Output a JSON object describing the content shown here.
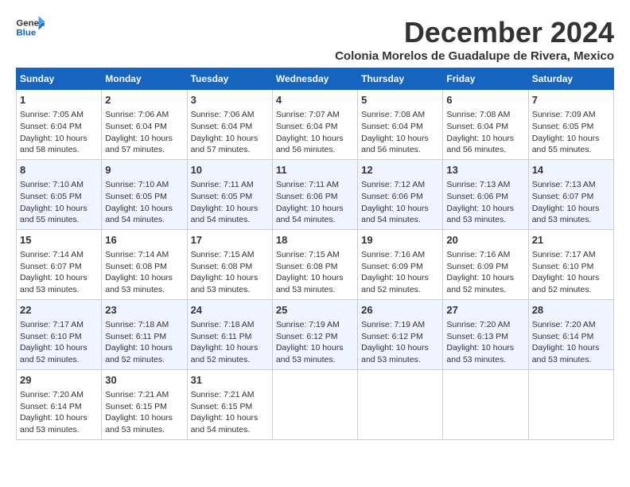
{
  "header": {
    "logo_line1": "General",
    "logo_line2": "Blue",
    "title": "December 2024",
    "subtitle": "Colonia Morelos de Guadalupe de Rivera, Mexico"
  },
  "calendar": {
    "weekdays": [
      "Sunday",
      "Monday",
      "Tuesday",
      "Wednesday",
      "Thursday",
      "Friday",
      "Saturday"
    ],
    "weeks": [
      [
        {
          "day": "1",
          "lines": [
            "Sunrise: 7:05 AM",
            "Sunset: 6:04 PM",
            "Daylight: 10 hours",
            "and 58 minutes."
          ]
        },
        {
          "day": "2",
          "lines": [
            "Sunrise: 7:06 AM",
            "Sunset: 6:04 PM",
            "Daylight: 10 hours",
            "and 57 minutes."
          ]
        },
        {
          "day": "3",
          "lines": [
            "Sunrise: 7:06 AM",
            "Sunset: 6:04 PM",
            "Daylight: 10 hours",
            "and 57 minutes."
          ]
        },
        {
          "day": "4",
          "lines": [
            "Sunrise: 7:07 AM",
            "Sunset: 6:04 PM",
            "Daylight: 10 hours",
            "and 56 minutes."
          ]
        },
        {
          "day": "5",
          "lines": [
            "Sunrise: 7:08 AM",
            "Sunset: 6:04 PM",
            "Daylight: 10 hours",
            "and 56 minutes."
          ]
        },
        {
          "day": "6",
          "lines": [
            "Sunrise: 7:08 AM",
            "Sunset: 6:04 PM",
            "Daylight: 10 hours",
            "and 56 minutes."
          ]
        },
        {
          "day": "7",
          "lines": [
            "Sunrise: 7:09 AM",
            "Sunset: 6:05 PM",
            "Daylight: 10 hours",
            "and 55 minutes."
          ]
        }
      ],
      [
        {
          "day": "8",
          "lines": [
            "Sunrise: 7:10 AM",
            "Sunset: 6:05 PM",
            "Daylight: 10 hours",
            "and 55 minutes."
          ]
        },
        {
          "day": "9",
          "lines": [
            "Sunrise: 7:10 AM",
            "Sunset: 6:05 PM",
            "Daylight: 10 hours",
            "and 54 minutes."
          ]
        },
        {
          "day": "10",
          "lines": [
            "Sunrise: 7:11 AM",
            "Sunset: 6:05 PM",
            "Daylight: 10 hours",
            "and 54 minutes."
          ]
        },
        {
          "day": "11",
          "lines": [
            "Sunrise: 7:11 AM",
            "Sunset: 6:06 PM",
            "Daylight: 10 hours",
            "and 54 minutes."
          ]
        },
        {
          "day": "12",
          "lines": [
            "Sunrise: 7:12 AM",
            "Sunset: 6:06 PM",
            "Daylight: 10 hours",
            "and 54 minutes."
          ]
        },
        {
          "day": "13",
          "lines": [
            "Sunrise: 7:13 AM",
            "Sunset: 6:06 PM",
            "Daylight: 10 hours",
            "and 53 minutes."
          ]
        },
        {
          "day": "14",
          "lines": [
            "Sunrise: 7:13 AM",
            "Sunset: 6:07 PM",
            "Daylight: 10 hours",
            "and 53 minutes."
          ]
        }
      ],
      [
        {
          "day": "15",
          "lines": [
            "Sunrise: 7:14 AM",
            "Sunset: 6:07 PM",
            "Daylight: 10 hours",
            "and 53 minutes."
          ]
        },
        {
          "day": "16",
          "lines": [
            "Sunrise: 7:14 AM",
            "Sunset: 6:08 PM",
            "Daylight: 10 hours",
            "and 53 minutes."
          ]
        },
        {
          "day": "17",
          "lines": [
            "Sunrise: 7:15 AM",
            "Sunset: 6:08 PM",
            "Daylight: 10 hours",
            "and 53 minutes."
          ]
        },
        {
          "day": "18",
          "lines": [
            "Sunrise: 7:15 AM",
            "Sunset: 6:08 PM",
            "Daylight: 10 hours",
            "and 53 minutes."
          ]
        },
        {
          "day": "19",
          "lines": [
            "Sunrise: 7:16 AM",
            "Sunset: 6:09 PM",
            "Daylight: 10 hours",
            "and 52 minutes."
          ]
        },
        {
          "day": "20",
          "lines": [
            "Sunrise: 7:16 AM",
            "Sunset: 6:09 PM",
            "Daylight: 10 hours",
            "and 52 minutes."
          ]
        },
        {
          "day": "21",
          "lines": [
            "Sunrise: 7:17 AM",
            "Sunset: 6:10 PM",
            "Daylight: 10 hours",
            "and 52 minutes."
          ]
        }
      ],
      [
        {
          "day": "22",
          "lines": [
            "Sunrise: 7:17 AM",
            "Sunset: 6:10 PM",
            "Daylight: 10 hours",
            "and 52 minutes."
          ]
        },
        {
          "day": "23",
          "lines": [
            "Sunrise: 7:18 AM",
            "Sunset: 6:11 PM",
            "Daylight: 10 hours",
            "and 52 minutes."
          ]
        },
        {
          "day": "24",
          "lines": [
            "Sunrise: 7:18 AM",
            "Sunset: 6:11 PM",
            "Daylight: 10 hours",
            "and 52 minutes."
          ]
        },
        {
          "day": "25",
          "lines": [
            "Sunrise: 7:19 AM",
            "Sunset: 6:12 PM",
            "Daylight: 10 hours",
            "and 53 minutes."
          ]
        },
        {
          "day": "26",
          "lines": [
            "Sunrise: 7:19 AM",
            "Sunset: 6:12 PM",
            "Daylight: 10 hours",
            "and 53 minutes."
          ]
        },
        {
          "day": "27",
          "lines": [
            "Sunrise: 7:20 AM",
            "Sunset: 6:13 PM",
            "Daylight: 10 hours",
            "and 53 minutes."
          ]
        },
        {
          "day": "28",
          "lines": [
            "Sunrise: 7:20 AM",
            "Sunset: 6:14 PM",
            "Daylight: 10 hours",
            "and 53 minutes."
          ]
        }
      ],
      [
        {
          "day": "29",
          "lines": [
            "Sunrise: 7:20 AM",
            "Sunset: 6:14 PM",
            "Daylight: 10 hours",
            "and 53 minutes."
          ]
        },
        {
          "day": "30",
          "lines": [
            "Sunrise: 7:21 AM",
            "Sunset: 6:15 PM",
            "Daylight: 10 hours",
            "and 53 minutes."
          ]
        },
        {
          "day": "31",
          "lines": [
            "Sunrise: 7:21 AM",
            "Sunset: 6:15 PM",
            "Daylight: 10 hours",
            "and 54 minutes."
          ]
        },
        null,
        null,
        null,
        null
      ]
    ]
  }
}
